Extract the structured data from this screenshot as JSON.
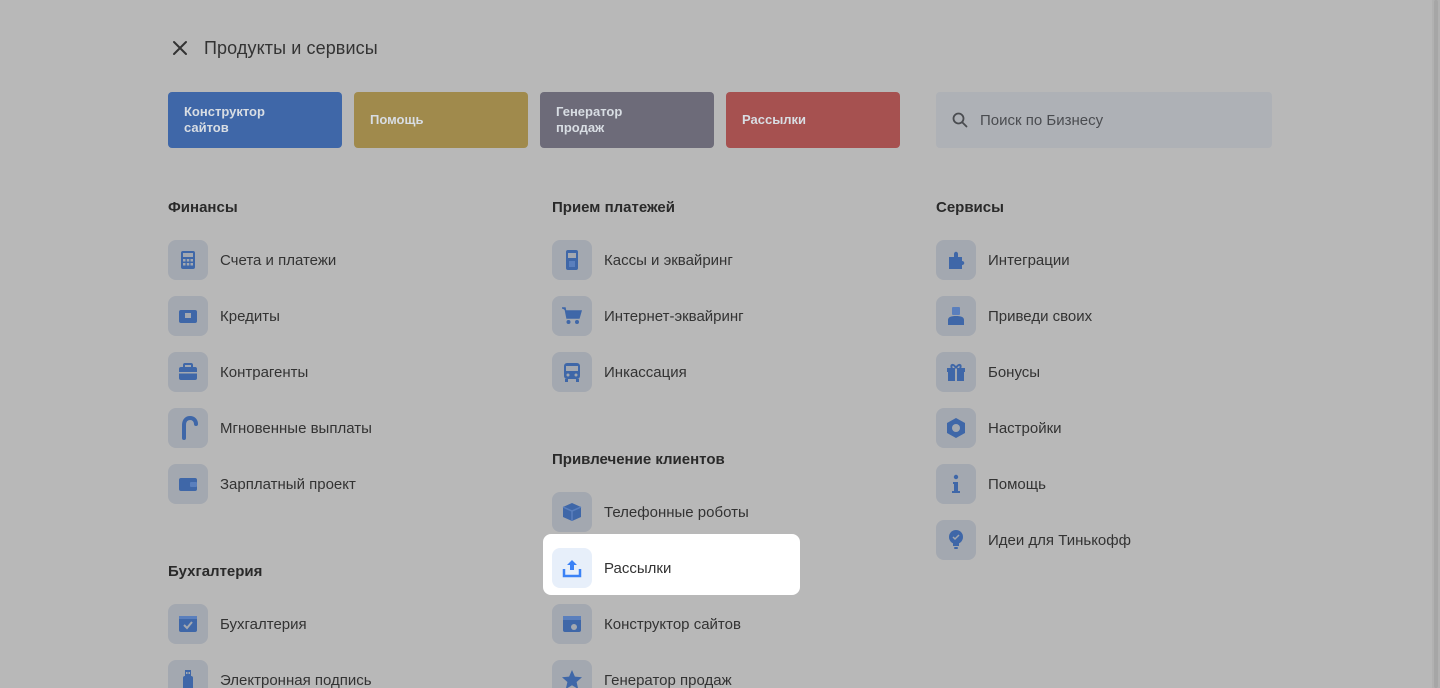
{
  "header": {
    "title": "Продукты и сервисы"
  },
  "quick_links": [
    {
      "label": "Конструктор сайтов",
      "color": "#3f67a8"
    },
    {
      "label": "Помощь",
      "color": "#a08a4c"
    },
    {
      "label": "Генератор продаж",
      "color": "#6d6b79"
    },
    {
      "label": "Рассылки",
      "color": "#a65150"
    }
  ],
  "search": {
    "placeholder": "Поиск по Бизнесу"
  },
  "columns": [
    {
      "sections": [
        {
          "title": "Финансы",
          "items": [
            {
              "label": "Счета и платежи",
              "icon": "calculator-icon"
            },
            {
              "label": "Кредиты",
              "icon": "card-icon"
            },
            {
              "label": "Контрагенты",
              "icon": "briefcase-icon"
            },
            {
              "label": "Мгновенные выплаты",
              "icon": "payout-icon"
            },
            {
              "label": "Зарплатный проект",
              "icon": "wallet-icon"
            }
          ]
        },
        {
          "title": "Бухгалтерия",
          "items": [
            {
              "label": "Бухгалтерия",
              "icon": "checklist-icon"
            },
            {
              "label": "Электронная подпись",
              "icon": "usb-key-icon"
            }
          ]
        }
      ]
    },
    {
      "sections": [
        {
          "title": "Прием платежей",
          "items": [
            {
              "label": "Кассы и эквайринг",
              "icon": "terminal-icon"
            },
            {
              "label": "Интернет-эквайринг",
              "icon": "cart-icon"
            },
            {
              "label": "Инкассация",
              "icon": "van-icon"
            }
          ]
        },
        {
          "title": "Привлечение клиентов",
          "items": [
            {
              "label": "Телефонные роботы",
              "icon": "cube-icon"
            },
            {
              "label": "Рассылки",
              "icon": "upload-icon",
              "active": true
            },
            {
              "label": "Конструктор сайтов",
              "icon": "site-builder-icon"
            },
            {
              "label": "Генератор продаж",
              "icon": "star-icon"
            }
          ]
        }
      ]
    },
    {
      "sections": [
        {
          "title": "Сервисы",
          "items": [
            {
              "label": "Интеграции",
              "icon": "puzzle-icon"
            },
            {
              "label": "Приведи своих",
              "icon": "people-icon"
            },
            {
              "label": "Бонусы",
              "icon": "gift-icon"
            },
            {
              "label": "Настройки",
              "icon": "hex-nut-icon"
            },
            {
              "label": "Помощь",
              "icon": "info-icon"
            },
            {
              "label": "Идеи для Тинькофф",
              "icon": "lightbulb-icon"
            }
          ]
        }
      ]
    }
  ],
  "colors": {
    "icon_blue": "#3f67a8",
    "active_icon_blue": "#3b82f6",
    "overlay": "#b8b8b8"
  }
}
